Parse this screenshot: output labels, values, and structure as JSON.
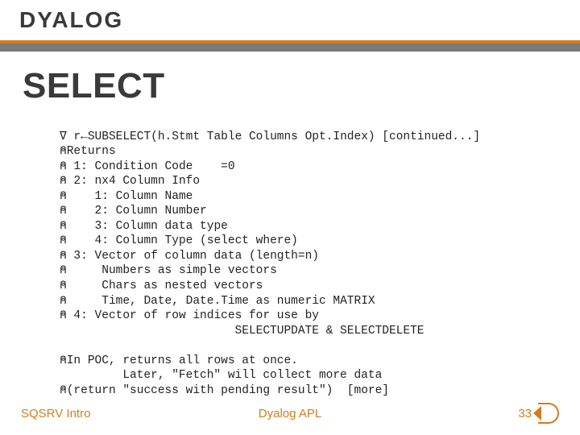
{
  "brand": "DYALOG",
  "title": "SELECT",
  "code": {
    "l01": "∇ r←SUBSELECT(h.Stmt Table Columns Opt.Index) [continued...]",
    "l02": "⍝Returns",
    "l03": "⍝ 1: Condition Code    =0",
    "l04": "⍝ 2: nx4 Column Info",
    "l05": "⍝    1: Column Name",
    "l06": "⍝    2: Column Number",
    "l07": "⍝    3: Column data type",
    "l08": "⍝    4: Column Type (select where)",
    "l09": "⍝ 3: Vector of column data (length=n)",
    "l10": "⍝     Numbers as simple vectors",
    "l11": "⍝     Chars as nested vectors",
    "l12": "⍝     Time, Date, Date.Time as numeric MATRIX",
    "l13": "⍝ 4: Vector of row indices for use by",
    "l14": "                         SELECTUPDATE & SELECTDELETE",
    "l15": "",
    "l16": "⍝In POC, returns all rows at once.",
    "l17": "         Later, \"Fetch\" will collect more data",
    "l18": "⍝(return \"success with pending result\")  [more]"
  },
  "footer": {
    "left": "SQSRV Intro",
    "center": "Dyalog APL",
    "page": "33"
  }
}
